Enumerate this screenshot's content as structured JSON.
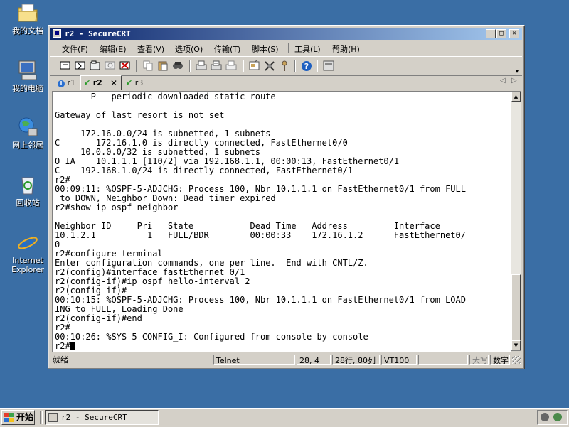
{
  "desktop": {
    "icons": [
      {
        "label": "我的文档"
      },
      {
        "label": "我的电脑"
      },
      {
        "label": "网上邻居"
      },
      {
        "label": "回收站"
      },
      {
        "label": "Internet Explorer"
      }
    ]
  },
  "window": {
    "title": "r2 - SecureCRT",
    "menu": [
      "文件(F)",
      "编辑(E)",
      "查看(V)",
      "选项(O)",
      "传输(T)",
      "脚本(S)",
      "工具(L)",
      "帮助(H)"
    ],
    "tabs": [
      {
        "label": "r1",
        "status": "info"
      },
      {
        "label": "r2",
        "status": "connected",
        "active": true
      },
      {
        "label": "r3",
        "status": "connected"
      }
    ],
    "terminal_lines": [
      "       P - periodic downloaded static route",
      "",
      "Gateway of last resort is not set",
      "",
      "     172.16.0.0/24 is subnetted, 1 subnets",
      "C       172.16.1.0 is directly connected, FastEthernet0/0",
      "     10.0.0.0/32 is subnetted, 1 subnets",
      "O IA    10.1.1.1 [110/2] via 192.168.1.1, 00:00:13, FastEthernet0/1",
      "C    192.168.1.0/24 is directly connected, FastEthernet0/1",
      "r2#",
      "00:09:11: %OSPF-5-ADJCHG: Process 100, Nbr 10.1.1.1 on FastEthernet0/1 from FULL",
      " to DOWN, Neighbor Down: Dead timer expired",
      "r2#show ip ospf neighbor",
      "",
      "Neighbor ID     Pri   State           Dead Time   Address         Interface",
      "10.1.2.1          1   FULL/BDR        00:00:33    172.16.1.2      FastEthernet0/",
      "0",
      "r2#configure terminal",
      "Enter configuration commands, one per line.  End with CNTL/Z.",
      "r2(config)#interface fastEthernet 0/1",
      "r2(config-if)#ip ospf hello-interval 2",
      "r2(config-if)#",
      "00:10:15: %OSPF-5-ADJCHG: Process 100, Nbr 10.1.1.1 on FastEthernet0/1 from LOAD",
      "ING to FULL, Loading Done",
      "r2(config-if)#end",
      "r2#",
      "00:10:26: %SYS-5-CONFIG_I: Configured from console by console",
      "r2#"
    ],
    "status": {
      "ready": "就绪",
      "protocol": "Telnet",
      "cursor_pos": "28,  4",
      "size": "28行, 80列",
      "emulation": "VT100",
      "caps": "大写",
      "num": "数字"
    }
  },
  "taskbar": {
    "start_label": "开始",
    "task_label": "r2 - SecureCRT"
  },
  "colors": {
    "desktop": "#3a6ea5",
    "title_active": "#0a246a",
    "chrome": "#d4d0c8"
  }
}
